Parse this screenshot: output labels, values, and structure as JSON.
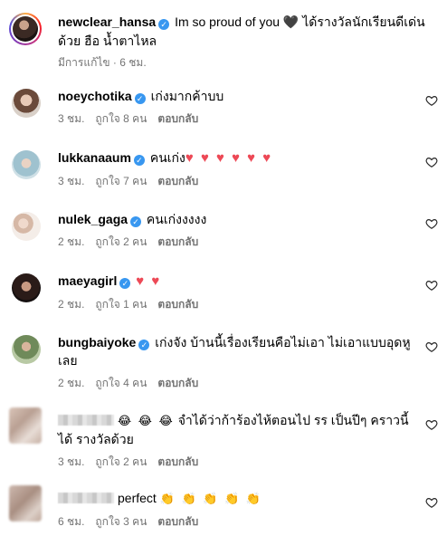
{
  "post": {
    "username": "newclear_hansa",
    "caption": "Im so proud of you 🖤 ได้รางวัลนักเรียนดีเด่น ด้วย ฮือ น้ำตาไหล",
    "edited": "มีการแก้ไข · 6 ชม."
  },
  "labels": {
    "reply": "ตอบกลับ"
  },
  "comments": [
    {
      "username": "noeychotika",
      "text": "เก่งมากค้าบบ",
      "time": "3 ชม.",
      "likes": "ถูกใจ 8 คน"
    },
    {
      "username": "lukkanaaum",
      "text": "คนเก่ง",
      "hearts": "♥ ♥ ♥ ♥ ♥ ♥",
      "time": "3 ชม.",
      "likes": "ถูกใจ 7 คน"
    },
    {
      "username": "nulek_gaga",
      "text": "คนเก่งงงงง",
      "time": "2 ชม.",
      "likes": "ถูกใจ 2 คน"
    },
    {
      "username": "maeyagirl",
      "hearts": "♥ ♥",
      "time": "2 ชม.",
      "likes": "ถูกใจ 1 คน"
    },
    {
      "username": "bungbaiyoke",
      "text": "เก่งจัง บ้านนี้เรื่องเรียนคือไม่เอา ไม่เอาแบบอุดหู เลย",
      "time": "2 ชม.",
      "likes": "ถูกใจ 4 คน"
    },
    {
      "emoji": "😂 😂 😂",
      "text": "จำได้ว่าก้าร้องไห้ตอนไป รร เป็นปีๆ คราวนี้ได้ รางวัลด้วย",
      "time": "3 ชม.",
      "likes": "ถูกใจ 2 คน"
    },
    {
      "text": "perfect",
      "emoji": "👏 👏 👏 👏 👏",
      "time": "6 ชม.",
      "likes": "ถูกใจ 3 คน"
    }
  ]
}
